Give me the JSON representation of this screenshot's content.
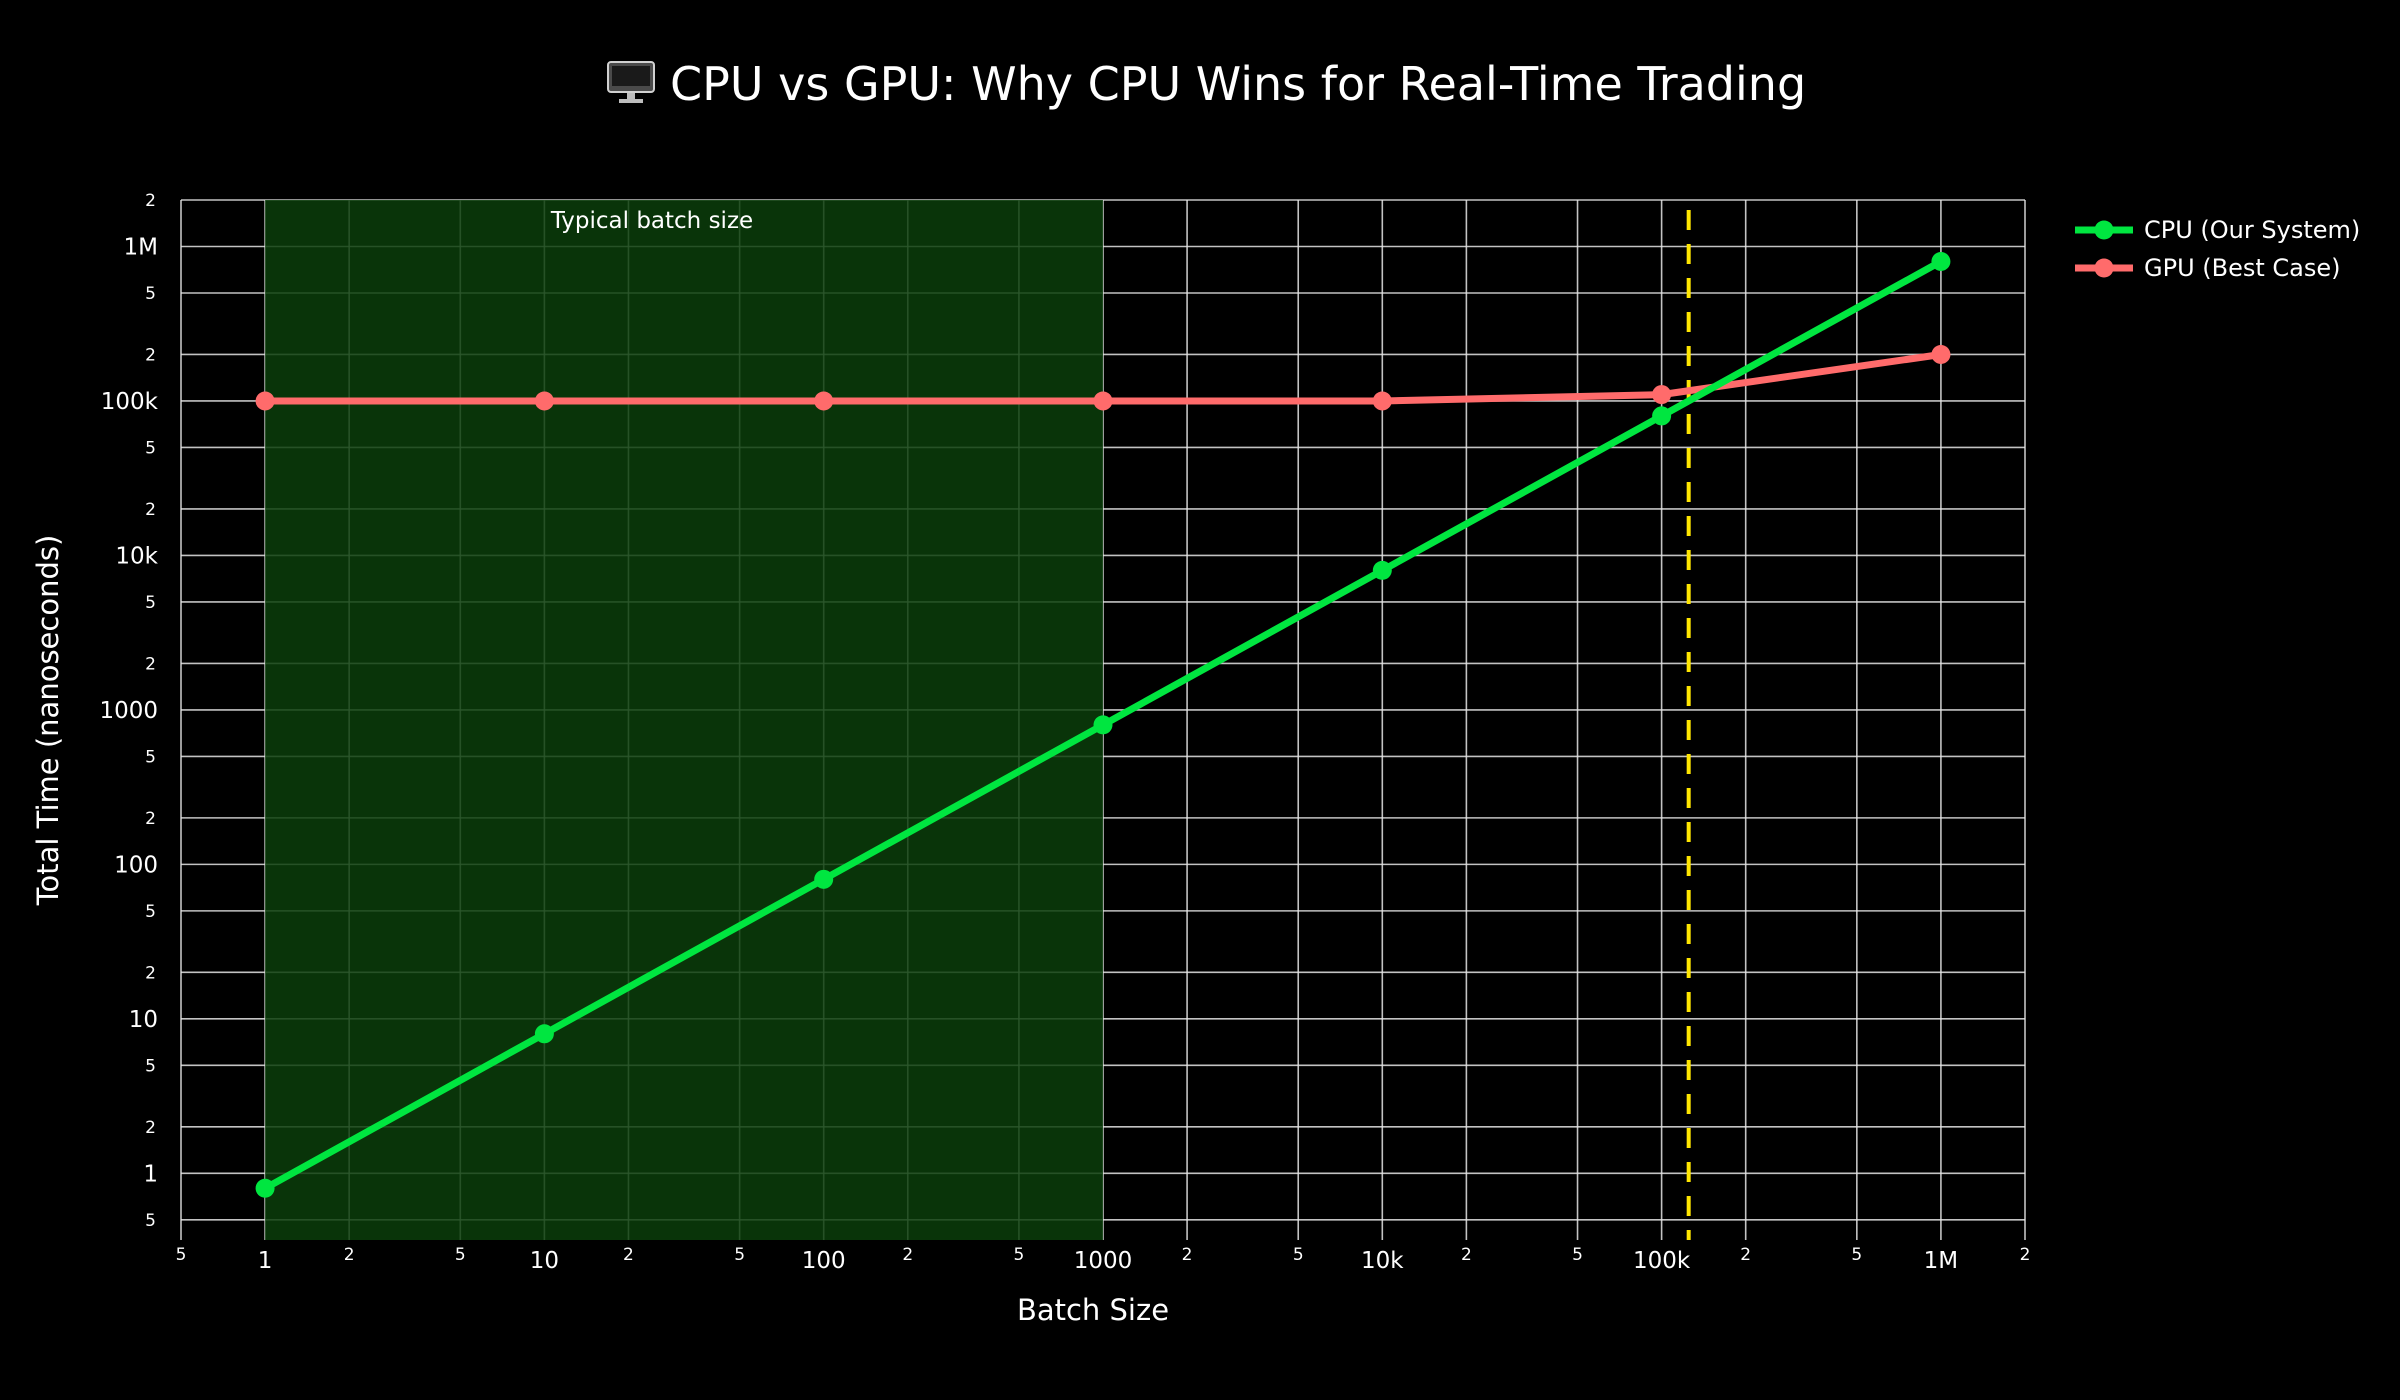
{
  "chart_data": {
    "type": "line",
    "title": "CPU vs GPU: Why CPU Wins for Real-Time Trading",
    "title_icon": "desktop-computer-icon",
    "xlabel": "Batch Size",
    "ylabel": "Total Time (nanoseconds)",
    "x_scale": "log",
    "y_scale": "log",
    "xlim": [
      0.5,
      2000000
    ],
    "ylim": [
      0.37,
      2000000
    ],
    "x": [
      1,
      10,
      100,
      1000,
      10000,
      100000,
      1000000
    ],
    "series": [
      {
        "name": "CPU (Our System)",
        "color": "#00e640",
        "values": [
          0.8,
          8,
          80,
          800,
          8000,
          80000,
          800000
        ]
      },
      {
        "name": "GPU (Best Case)",
        "color": "#ff6b6b",
        "values": [
          100000,
          100000,
          100000,
          100000,
          100000,
          110000,
          200000
        ]
      }
    ],
    "shaded_region": {
      "x_range": [
        1,
        1000
      ],
      "color": "#0b3d0b",
      "label": "Typical batch size"
    },
    "vertical_line": {
      "x": 125000,
      "color": "#ffe600",
      "style": "dashed"
    },
    "x_ticks": [
      {
        "value": 0.5,
        "label": "5"
      },
      {
        "value": 1,
        "label": "1"
      },
      {
        "value": 2,
        "label": "2"
      },
      {
        "value": 5,
        "label": "5"
      },
      {
        "value": 10,
        "label": "10"
      },
      {
        "value": 20,
        "label": "2"
      },
      {
        "value": 50,
        "label": "5"
      },
      {
        "value": 100,
        "label": "100"
      },
      {
        "value": 200,
        "label": "2"
      },
      {
        "value": 500,
        "label": "5"
      },
      {
        "value": 1000,
        "label": "1000"
      },
      {
        "value": 2000,
        "label": "2"
      },
      {
        "value": 5000,
        "label": "5"
      },
      {
        "value": 10000,
        "label": "10k"
      },
      {
        "value": 20000,
        "label": "2"
      },
      {
        "value": 50000,
        "label": "5"
      },
      {
        "value": 100000,
        "label": "100k"
      },
      {
        "value": 200000,
        "label": "2"
      },
      {
        "value": 500000,
        "label": "5"
      },
      {
        "value": 1000000,
        "label": "1M"
      },
      {
        "value": 2000000,
        "label": "2"
      }
    ],
    "y_ticks": [
      {
        "value": 0.5,
        "label": "5"
      },
      {
        "value": 1,
        "label": "1"
      },
      {
        "value": 2,
        "label": "2"
      },
      {
        "value": 5,
        "label": "5"
      },
      {
        "value": 10,
        "label": "10"
      },
      {
        "value": 20,
        "label": "2"
      },
      {
        "value": 50,
        "label": "5"
      },
      {
        "value": 100,
        "label": "100"
      },
      {
        "value": 200,
        "label": "2"
      },
      {
        "value": 500,
        "label": "5"
      },
      {
        "value": 1000,
        "label": "1000"
      },
      {
        "value": 2000,
        "label": "2"
      },
      {
        "value": 5000,
        "label": "5"
      },
      {
        "value": 10000,
        "label": "10k"
      },
      {
        "value": 20000,
        "label": "2"
      },
      {
        "value": 50000,
        "label": "5"
      },
      {
        "value": 100000,
        "label": "100k"
      },
      {
        "value": 200000,
        "label": "2"
      },
      {
        "value": 500000,
        "label": "5"
      },
      {
        "value": 1000000,
        "label": "1M"
      },
      {
        "value": 2000000,
        "label": "2"
      }
    ],
    "grid": true,
    "legend_position": "top-right outside",
    "background": "#000000"
  }
}
